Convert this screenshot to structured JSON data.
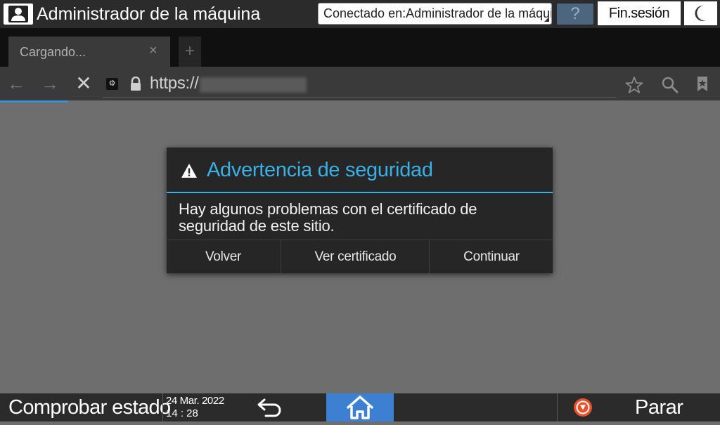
{
  "topbar": {
    "title": "Administrador de la máquina",
    "connected_label": "Conectado en:Administrador de la máquina",
    "help_label": "?",
    "logout_label": "Fin.sesión"
  },
  "browser": {
    "tab_title": "Cargando...",
    "tab_close": "×",
    "new_tab": "+",
    "back": "←",
    "forward": "→",
    "stop": "✕",
    "url_prefix": "https://"
  },
  "dialog": {
    "title": "Advertencia de seguridad",
    "message": "Hay algunos problemas con el certificado de seguridad de este sitio.",
    "buttons": [
      "Volver",
      "Ver certificado",
      "Continuar"
    ],
    "accent_color": "#3ab0e6"
  },
  "bottombar": {
    "check_status_label": "Comprobar estado",
    "date": "24 Mar. 2022",
    "time": "14 : 28",
    "stop_label": "Parar",
    "home_color": "#3d7fd0"
  },
  "icons": [
    "user-icon",
    "moon-icon",
    "site-icon",
    "lock-icon",
    "star-icon",
    "search-icon",
    "bookmark-icon",
    "warning-icon",
    "back-arrow-icon",
    "home-icon",
    "stop-icon"
  ]
}
